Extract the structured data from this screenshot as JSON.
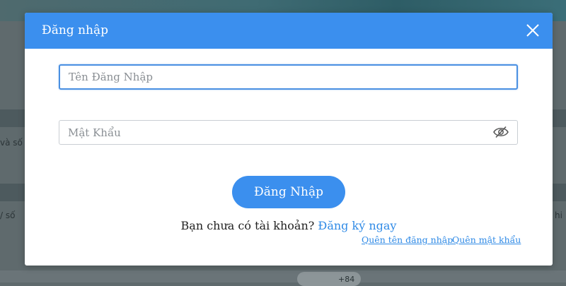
{
  "background": {
    "left_text_1": "và số",
    "left_text_2": "/ số",
    "right_text_2": "hi",
    "bottom_text": "+84"
  },
  "modal": {
    "title": "Đăng nhập",
    "close_icon": "close-icon",
    "username": {
      "placeholder": "Tên Đăng Nhập",
      "value": ""
    },
    "password": {
      "placeholder": "Mật Khẩu",
      "value": "",
      "toggle_icon": "eye-slash-icon"
    },
    "login_button": "Đăng Nhập",
    "signup_prompt": "Bạn chưa có tài khoản?",
    "signup_link": "Đăng ký ngay",
    "forgot_username": "Quên tên đăng nhập",
    "forgot_password": "Quên mật khẩu"
  },
  "colors": {
    "accent": "#3b8fee",
    "link": "#2f8ae6"
  }
}
